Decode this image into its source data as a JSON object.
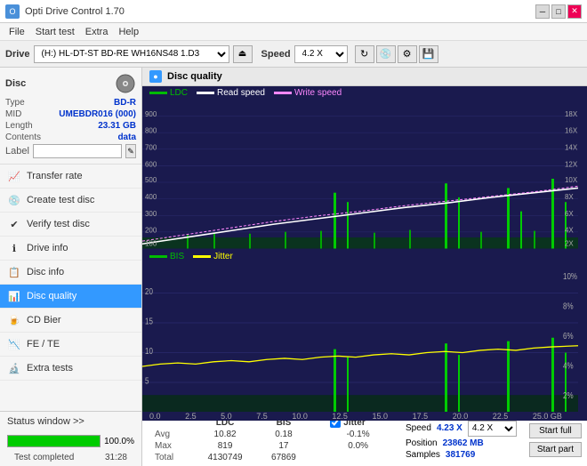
{
  "titlebar": {
    "icon": "O",
    "title": "Opti Drive Control 1.70",
    "minimize": "─",
    "maximize": "□",
    "close": "✕"
  },
  "menubar": {
    "items": [
      "File",
      "Start test",
      "Extra",
      "Help"
    ]
  },
  "drivetoolbar": {
    "drive_label": "Drive",
    "drive_value": "(H:) HL-DT-ST BD-RE  WH16NS48 1.D3",
    "speed_label": "Speed",
    "speed_value": "4.2 X"
  },
  "disc": {
    "title": "Disc",
    "type_label": "Type",
    "type_value": "BD-R",
    "mid_label": "MID",
    "mid_value": "UMEBDR016 (000)",
    "length_label": "Length",
    "length_value": "23.31 GB",
    "contents_label": "Contents",
    "contents_value": "data",
    "label_label": "Label",
    "label_value": ""
  },
  "sidebar": {
    "items": [
      {
        "id": "transfer-rate",
        "label": "Transfer rate",
        "icon": "📈"
      },
      {
        "id": "create-test-disc",
        "label": "Create test disc",
        "icon": "💿"
      },
      {
        "id": "verify-test-disc",
        "label": "Verify test disc",
        "icon": "✔"
      },
      {
        "id": "drive-info",
        "label": "Drive info",
        "icon": "ℹ"
      },
      {
        "id": "disc-info",
        "label": "Disc info",
        "icon": "📋"
      },
      {
        "id": "disc-quality",
        "label": "Disc quality",
        "icon": "📊",
        "active": true
      },
      {
        "id": "cd-bier",
        "label": "CD Bier",
        "icon": "🍺"
      },
      {
        "id": "fe-te",
        "label": "FE / TE",
        "icon": "📉"
      },
      {
        "id": "extra-tests",
        "label": "Extra tests",
        "icon": "🔬"
      }
    ]
  },
  "status": {
    "window_label": "Status window >>",
    "progress_pct": 100,
    "progress_label": "100.0%",
    "status_text": "Test completed",
    "time": "31:28"
  },
  "disc_quality": {
    "title": "Disc quality",
    "legend": {
      "ldc_label": "LDC",
      "ldc_color": "#00aa00",
      "read_speed_label": "Read speed",
      "read_speed_color": "#ffffff",
      "write_speed_label": "Write speed",
      "write_speed_color": "#ff88ff"
    },
    "chart1": {
      "y_max": 900,
      "y_right_max": 18,
      "x_max": 25,
      "y_labels_left": [
        "900",
        "800",
        "700",
        "600",
        "500",
        "400",
        "300",
        "200",
        "100"
      ],
      "y_labels_right": [
        "18X",
        "16X",
        "14X",
        "12X",
        "10X",
        "8X",
        "6X",
        "4X",
        "2X"
      ],
      "x_labels": [
        "0.0",
        "2.5",
        "5.0",
        "7.5",
        "10.0",
        "12.5",
        "15.0",
        "17.5",
        "20.0",
        "22.5",
        "25.0"
      ]
    },
    "chart2": {
      "legend": {
        "bis_label": "BIS",
        "bis_color": "#00aa00",
        "jitter_label": "Jitter",
        "jitter_color": "#ffff00"
      },
      "y_max": 20,
      "y_right_max": 10,
      "x_max": 25,
      "y_labels_left": [
        "20",
        "15",
        "10",
        "5"
      ],
      "y_labels_right": [
        "10%",
        "8%",
        "6%",
        "4%",
        "2%"
      ],
      "x_labels": [
        "0.0",
        "2.5",
        "5.0",
        "7.5",
        "10.0",
        "12.5",
        "15.0",
        "17.5",
        "20.0",
        "22.5",
        "25.0"
      ]
    }
  },
  "stats": {
    "headers": [
      "",
      "LDC",
      "BIS",
      "",
      "Jitter",
      "Speed",
      ""
    ],
    "avg_label": "Avg",
    "avg_ldc": "10.82",
    "avg_bis": "0.18",
    "avg_jitter": "-0.1%",
    "max_label": "Max",
    "max_ldc": "819",
    "max_bis": "17",
    "max_jitter": "0.0%",
    "total_label": "Total",
    "total_ldc": "4130749",
    "total_bis": "67869",
    "speed_label": "Speed",
    "speed_value": "4.23 X",
    "speed_select": "4.2 X",
    "position_label": "Position",
    "position_value": "23862 MB",
    "samples_label": "Samples",
    "samples_value": "381769",
    "start_full_label": "Start full",
    "start_part_label": "Start part",
    "jitter_checked": true
  }
}
